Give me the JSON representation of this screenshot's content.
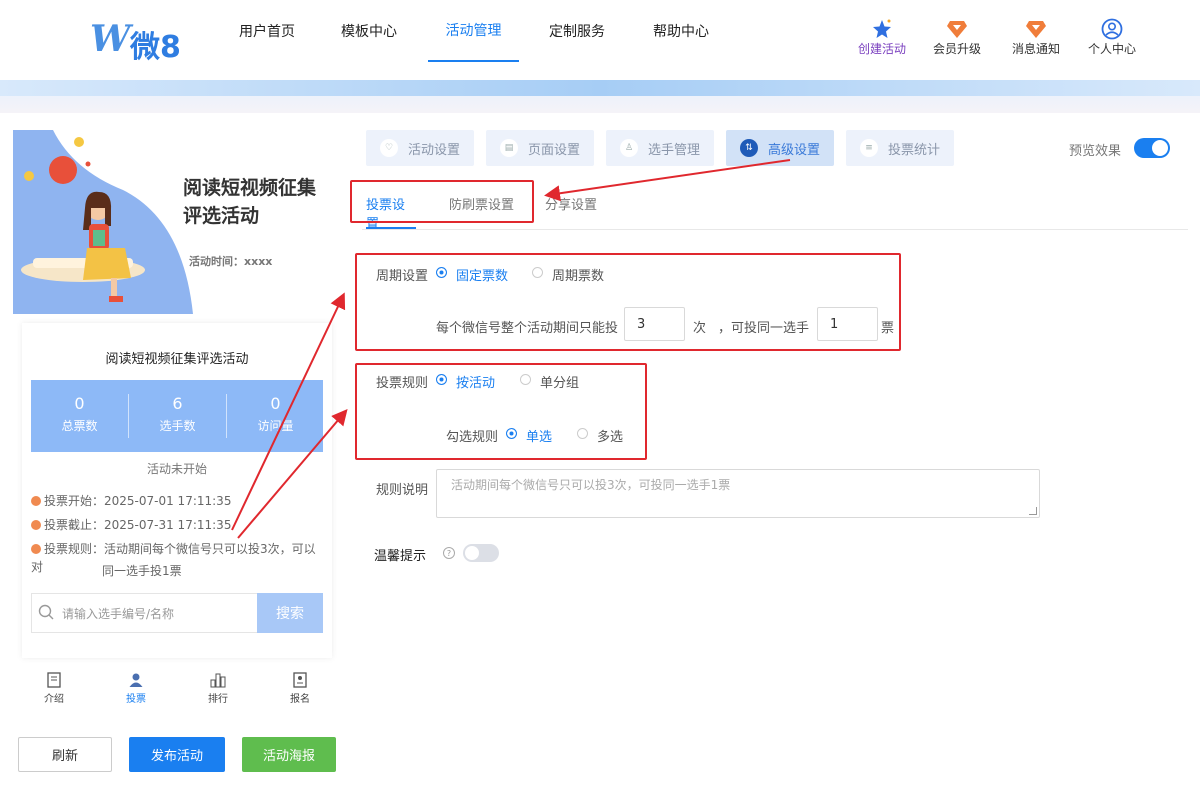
{
  "brand": {
    "logo_text": "微8"
  },
  "nav": {
    "items": [
      {
        "label": "用户首页"
      },
      {
        "label": "模板中心"
      },
      {
        "label": "活动管理"
      },
      {
        "label": "定制服务"
      },
      {
        "label": "帮助中心"
      }
    ],
    "active": 2
  },
  "right_nav": {
    "items": [
      {
        "label": "创建活动",
        "icon": "star-icon"
      },
      {
        "label": "会员升级",
        "icon": "diamond-icon"
      },
      {
        "label": "消息通知",
        "icon": "diamond-icon"
      },
      {
        "label": "个人中心",
        "icon": "user-icon"
      }
    ]
  },
  "preview": {
    "hero_title": "阅读短视频征集评选活动",
    "hero_time": "活动时间：xxxx",
    "card_title": "阅读短视频征集评选活动",
    "stats": [
      {
        "value": "0",
        "label": "总票数"
      },
      {
        "value": "6",
        "label": "选手数"
      },
      {
        "value": "0",
        "label": "访问量"
      }
    ],
    "status": "活动未开始",
    "vote_start": "投票开始：2025-07-01 17:11:35",
    "vote_end": "投票截止：2025-07-31 17:11:35",
    "vote_rule_1": "投票规则：活动期间每个微信号只可以投3次，可以对",
    "vote_rule_2": "同一选手投1票",
    "search_placeholder": "请输入选手编号/名称",
    "search_button": "搜索",
    "tabbar": [
      {
        "label": "介绍"
      },
      {
        "label": "投票"
      },
      {
        "label": "排行"
      },
      {
        "label": "报名"
      }
    ]
  },
  "actions": {
    "refresh": "刷新",
    "publish": "发布活动",
    "poster": "活动海报"
  },
  "settings": {
    "tabs": [
      {
        "label": "活动设置"
      },
      {
        "label": "页面设置"
      },
      {
        "label": "选手管理"
      },
      {
        "label": "高级设置"
      },
      {
        "label": "投票统计"
      }
    ],
    "active_tab": 3,
    "preview_label": "预览效果",
    "preview_enabled": true,
    "subtabs": [
      {
        "label": "投票设置"
      },
      {
        "label": "防刷票设置"
      },
      {
        "label": "分享设置"
      }
    ],
    "active_subtab": 0,
    "period": {
      "label": "周期设置",
      "options": [
        "固定票数",
        "周期票数"
      ],
      "selected": 0,
      "text_prefix": "每个微信号整个活动期间只能投",
      "times": "3",
      "unit_times": "次",
      "text_mid": "，可投同一选手",
      "votes": "1",
      "unit_votes": "票"
    },
    "rule": {
      "label": "投票规则",
      "options": [
        "按活动",
        "单分组"
      ],
      "selected": 0
    },
    "check": {
      "label": "勾选规则",
      "options": [
        "单选",
        "多选"
      ],
      "selected": 0
    },
    "description": {
      "label": "规则说明",
      "placeholder": "活动期间每个微信号只可以投3次，可投同一选手1票"
    },
    "tips": {
      "label": "温馨提示",
      "enabled": false
    }
  },
  "colors": {
    "accent": "#1a7ff0",
    "annotation": "#e0282e",
    "stats_bg": "#8db9f7",
    "poster_btn": "#5fbd4e"
  }
}
